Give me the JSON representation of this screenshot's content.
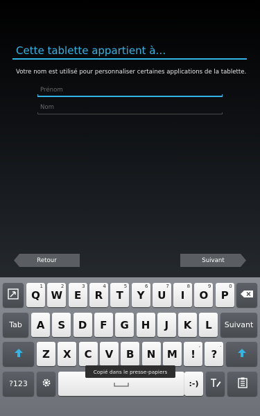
{
  "screen": {
    "title": "Cette tablette appartient à…",
    "description": "Votre nom est utilisé pour personnaliser certaines applications de la tablette.",
    "first_name_placeholder": "Prénom",
    "last_name_placeholder": "Nom",
    "back_label": "Retour",
    "next_label": "Suivant"
  },
  "keyboard": {
    "row1": [
      {
        "label": "Q",
        "sup": "1"
      },
      {
        "label": "W",
        "sup": "2"
      },
      {
        "label": "E",
        "sup": "3"
      },
      {
        "label": "R",
        "sup": "4"
      },
      {
        "label": "T",
        "sup": "5"
      },
      {
        "label": "Y",
        "sup": "6"
      },
      {
        "label": "U",
        "sup": "7"
      },
      {
        "label": "I",
        "sup": "8"
      },
      {
        "label": "O",
        "sup": "9"
      },
      {
        "label": "P",
        "sup": "0"
      }
    ],
    "row2": [
      "A",
      "S",
      "D",
      "F",
      "G",
      "H",
      "J",
      "K",
      "L"
    ],
    "row3": [
      "Z",
      "X",
      "C",
      "V",
      "B",
      "N",
      "M",
      "!",
      "?"
    ],
    "row3_sup": {
      "!": ",",
      "?": "."
    },
    "tab_label": "Tab",
    "enter_label": "Suivant",
    "symbols_label": "?123",
    "smiley_label": ":-)",
    "accent_color": "#33b5e5"
  },
  "toast": "Copié dans le presse-papiers",
  "icons": [
    "resize-icon",
    "backspace-icon",
    "shift-icon",
    "settings-icon",
    "space-icon",
    "handwriting-icon",
    "clipboard-icon"
  ]
}
